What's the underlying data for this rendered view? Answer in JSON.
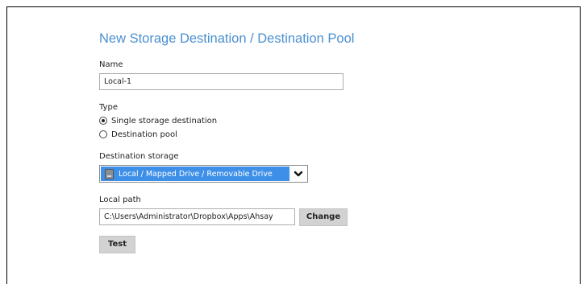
{
  "page": {
    "title": "New Storage Destination / Destination Pool"
  },
  "form": {
    "name_label": "Name",
    "name_value": "Local-1",
    "type_label": "Type",
    "type_options": [
      {
        "label": "Single storage destination",
        "checked": true
      },
      {
        "label": "Destination pool",
        "checked": false
      }
    ],
    "destination_storage_label": "Destination storage",
    "destination_storage_value": "Local / Mapped Drive / Removable Drive",
    "local_path_label": "Local path",
    "local_path_value": "C:\\Users\\Administrator\\Dropbox\\Apps\\Ahsay",
    "change_label": "Change",
    "test_label": "Test"
  },
  "colors": {
    "title": "#4a90d0",
    "select_highlight": "#3d8fe8",
    "button_bg": "#d2d2d2"
  },
  "icons": {
    "destination_storage": "hard-drive-icon",
    "dropdown": "chevron-down-icon"
  }
}
